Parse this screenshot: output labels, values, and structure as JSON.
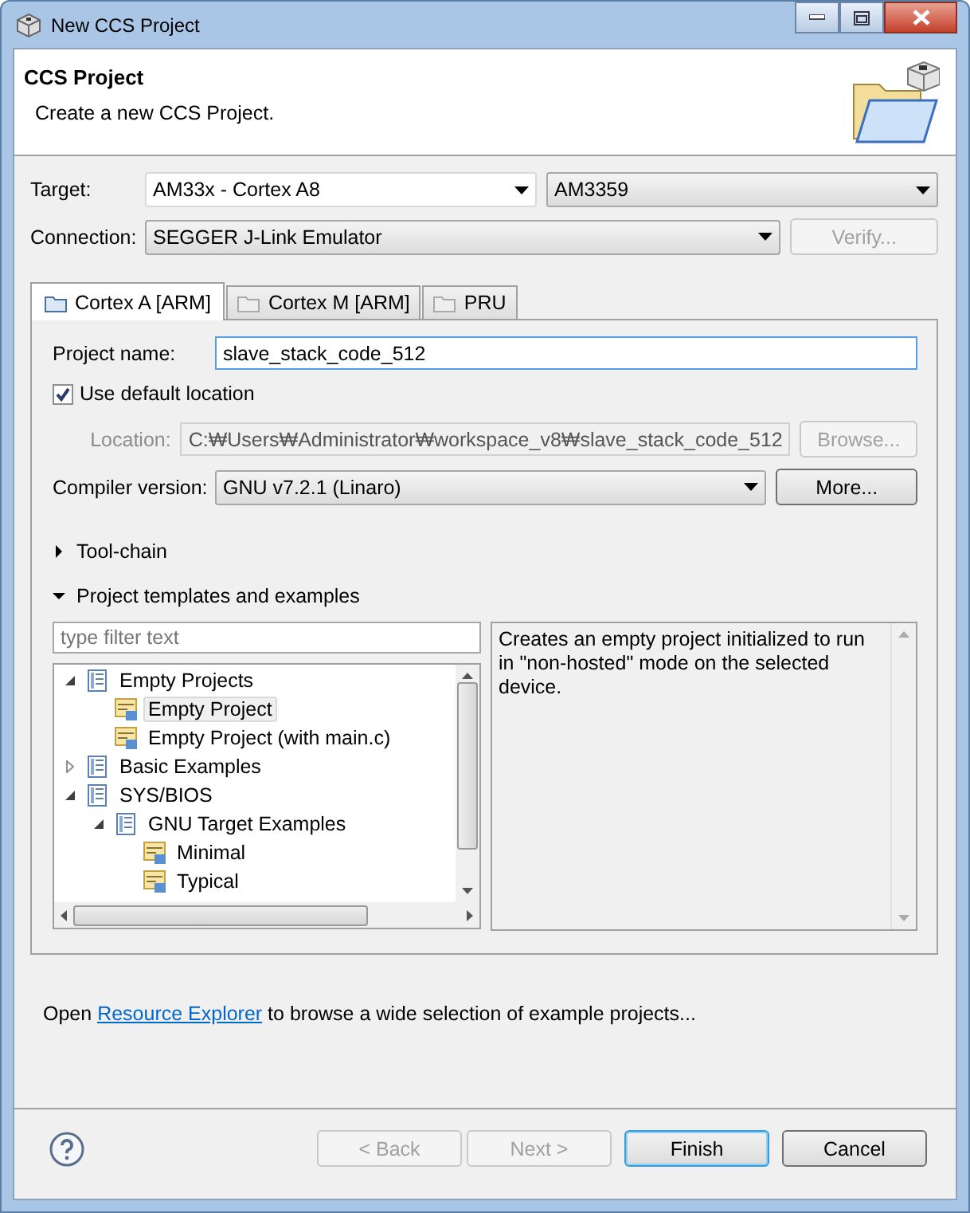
{
  "window": {
    "title": "New CCS Project"
  },
  "header": {
    "title": "CCS Project",
    "subtitle": "Create a new CCS Project."
  },
  "target": {
    "label": "Target:",
    "family": "AM33x - Cortex A8",
    "device": "AM3359"
  },
  "connection": {
    "label": "Connection:",
    "value": "SEGGER J-Link Emulator",
    "verify_button": {
      "label": "Verify...",
      "disabled": true
    }
  },
  "tabs": [
    {
      "label": "Cortex A [ARM]",
      "selected": true
    },
    {
      "label": "Cortex M [ARM]",
      "selected": false
    },
    {
      "label": "PRU",
      "selected": false
    }
  ],
  "project_name": {
    "label": "Project name:",
    "value": "slave_stack_code_512"
  },
  "use_default_location": {
    "label": "Use default location",
    "checked": true
  },
  "location": {
    "label": "Location:",
    "value": "C:₩Users₩Administrator₩workspace_v8₩slave_stack_code_512",
    "disabled": true,
    "browse_button": {
      "label": "Browse...",
      "disabled": true
    }
  },
  "compiler": {
    "label": "Compiler version:",
    "value": "GNU v7.2.1 (Linaro)",
    "more_button": {
      "label": "More...",
      "disabled": false
    }
  },
  "sections": [
    {
      "label": "Tool-chain",
      "expanded": false
    },
    {
      "label": "Project templates and examples",
      "expanded": true
    }
  ],
  "filter": {
    "placeholder": "type filter text"
  },
  "tree": [
    {
      "label": "Empty Projects",
      "kind": "folder",
      "expanded": true,
      "selected": false,
      "children": [
        {
          "label": "Empty Project",
          "kind": "template",
          "selected": true
        },
        {
          "label": "Empty Project (with main.c)",
          "kind": "template",
          "selected": false
        }
      ]
    },
    {
      "label": "Basic Examples",
      "kind": "folder",
      "expanded": false,
      "selected": false
    },
    {
      "label": "SYS/BIOS",
      "kind": "folder",
      "expanded": true,
      "selected": false,
      "children": [
        {
          "label": "GNU Target Examples",
          "kind": "folder",
          "expanded": true,
          "selected": false,
          "children": [
            {
              "label": "Minimal",
              "kind": "template",
              "selected": false
            },
            {
              "label": "Typical",
              "kind": "template",
              "selected": false
            }
          ]
        }
      ]
    }
  ],
  "description": "Creates an empty project initialized to run in \"non-hosted\" mode on the selected device.",
  "explorer_hint": {
    "before": "Open ",
    "link": "Resource Explorer",
    "after": " to browse a wide selection of example projects..."
  },
  "buttons": [
    {
      "label": "< Back",
      "disabled": true,
      "default": false
    },
    {
      "label": "Next >",
      "disabled": true,
      "default": false
    },
    {
      "label": "Finish",
      "disabled": false,
      "default": true
    },
    {
      "label": "Cancel",
      "disabled": false,
      "default": false
    }
  ]
}
